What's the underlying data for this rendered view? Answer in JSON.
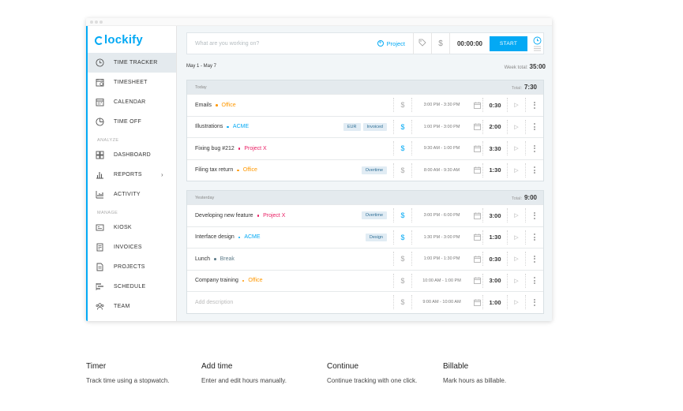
{
  "app": {
    "name": "lockify",
    "accent": "#03a9f4"
  },
  "sidebar": {
    "items": [
      {
        "label": "TIME TRACKER",
        "icon": "clock-icon",
        "active": true
      },
      {
        "label": "TIMESHEET",
        "icon": "timesheet-icon"
      },
      {
        "label": "CALENDAR",
        "icon": "calendar-icon"
      },
      {
        "label": "TIME OFF",
        "icon": "time-off-icon"
      }
    ],
    "analyze_label": "ANALYZE",
    "analyze_items": [
      {
        "label": "DASHBOARD",
        "icon": "dashboard-icon"
      },
      {
        "label": "REPORTS",
        "icon": "reports-icon"
      },
      {
        "label": "ACTIVITY",
        "icon": "activity-icon"
      }
    ],
    "manage_label": "MANAGE",
    "manage_items": [
      {
        "label": "KIOSK",
        "icon": "kiosk-icon"
      },
      {
        "label": "INVOICES",
        "icon": "invoices-icon"
      },
      {
        "label": "PROJECTS",
        "icon": "projects-icon"
      },
      {
        "label": "SCHEDULE",
        "icon": "schedule-icon"
      },
      {
        "label": "TEAM",
        "icon": "team-icon"
      }
    ]
  },
  "timer": {
    "placeholder": "What are you working on?",
    "project_label": "Project",
    "time": "00:00:00",
    "start_label": "START"
  },
  "week": {
    "range": "May 1 - May 7",
    "total_label": "Week total:",
    "total": "35:00"
  },
  "groups": [
    {
      "label": "Today",
      "total_label": "Total:",
      "total": "7:30",
      "entries": [
        {
          "desc": "Emails",
          "project": "Office",
          "color": "#ff9800",
          "tags": [],
          "billable": false,
          "range": "3:00 PM - 3:30 PM",
          "duration": "0:30"
        },
        {
          "desc": "Illustrations",
          "project": "ACME",
          "color": "#03a9f4",
          "tags": [
            "EUR",
            "Invoiced"
          ],
          "billable": true,
          "range": "1:00 PM - 3:00 PM",
          "duration": "2:00"
        },
        {
          "desc": "Fixing bug #212",
          "project": "Project X",
          "color": "#e91e63",
          "tags": [],
          "billable": true,
          "range": "9:30 AM - 1:00 PM",
          "duration": "3:30"
        },
        {
          "desc": "Filing tax return",
          "project": "Office",
          "color": "#ff9800",
          "tags": [
            "Overtime"
          ],
          "billable": false,
          "range": "8:00 AM - 9:30 AM",
          "duration": "1:30"
        }
      ]
    },
    {
      "label": "Yesterday",
      "total_label": "Total:",
      "total": "9:00",
      "entries": [
        {
          "desc": "Developing new feature",
          "project": "Project X",
          "color": "#e91e63",
          "tags": [
            "Overtime"
          ],
          "billable": true,
          "range": "3:00 PM - 6:00 PM",
          "duration": "3:00"
        },
        {
          "desc": "Interface design",
          "project": "ACME",
          "color": "#03a9f4",
          "tags": [
            "Design"
          ],
          "billable": true,
          "range": "1:30 PM - 3:00 PM",
          "duration": "1:30"
        },
        {
          "desc": "Lunch",
          "project": "Break",
          "color": "#607d8b",
          "tags": [],
          "billable": false,
          "range": "1:00 PM - 1:30 PM",
          "duration": "0:30"
        },
        {
          "desc": "Company training",
          "project": "Office",
          "color": "#ff9800",
          "tags": [],
          "billable": false,
          "range": "10:00 AM - 1:00 PM",
          "duration": "3:00"
        },
        {
          "desc": "",
          "placeholder": "Add description",
          "project": "",
          "color": "",
          "tags": [],
          "billable": false,
          "range": "9:00 AM - 10:00 AM",
          "duration": "1:00"
        }
      ]
    }
  ],
  "features": [
    {
      "title": "Timer",
      "desc": "Track time using a stopwatch."
    },
    {
      "title": "Add time",
      "desc": "Enter and edit hours manually."
    },
    {
      "title": "Continue",
      "desc": "Continue tracking with one click."
    },
    {
      "title": "Billable",
      "desc": "Mark hours as billable."
    }
  ]
}
